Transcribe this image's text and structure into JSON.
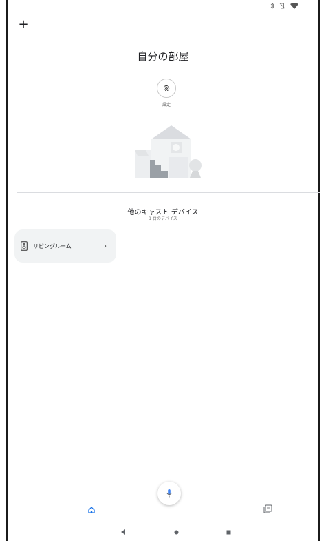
{
  "status_bar": {
    "icons": [
      "bluetooth-icon",
      "vibrate-off-icon",
      "wifi-icon"
    ]
  },
  "header": {
    "add_label": "+"
  },
  "home": {
    "title": "自分の部屋",
    "settings_label": "設定"
  },
  "other_devices": {
    "title": "他のキャスト デバイス",
    "subtitle": "1 台のデバイス",
    "items": [
      {
        "name": "リビングルーム",
        "chevron": "›",
        "icon": "speaker-icon"
      }
    ]
  },
  "bottom_nav": {
    "items": [
      "home-icon",
      "feed-icon"
    ],
    "accent": "#1a73e8"
  },
  "system_nav": {
    "back": "◀",
    "home": "●",
    "recent": "■"
  }
}
